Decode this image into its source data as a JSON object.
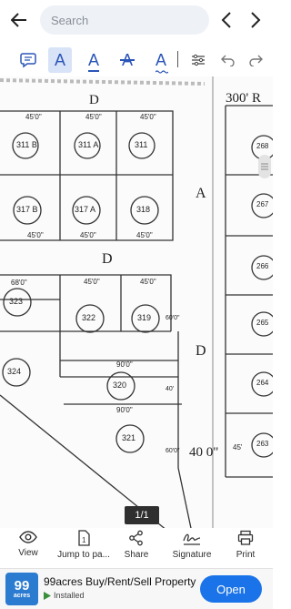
{
  "search": {
    "placeholder": "Search"
  },
  "toolbar": {
    "tools": [
      "comment-tool",
      "highlight-tool",
      "underline-tool",
      "strikethrough-tool",
      "squiggly-tool"
    ]
  },
  "document": {
    "top_dims": {
      "road_d": "D",
      "right_road": "300' R"
    },
    "plots_top": [
      {
        "label": "311 B",
        "dim": "45'0\""
      },
      {
        "label": "311 A",
        "dim": "45'0\""
      },
      {
        "label": "311",
        "dim": "45'0\""
      }
    ],
    "plots_mid": [
      {
        "label": "317 B",
        "dim": "45'0\""
      },
      {
        "label": "317 A",
        "dim": "45'0\""
      },
      {
        "label": "318",
        "dim": "45'0\""
      }
    ],
    "plots_lower": [
      "323",
      "322",
      "319",
      "324",
      "320",
      "321"
    ],
    "plots_right": [
      "268",
      "267",
      "266",
      "265",
      "264",
      "263"
    ],
    "road_labels": {
      "a": "A",
      "d_mid": "D",
      "d_right": "D"
    },
    "dims": {
      "d68": "68'0\"",
      "d45a": "45'0\"",
      "d45b": "45'0\"",
      "d60a": "60'0\"",
      "d90a": "90'0\"",
      "d40a": "40'",
      "d90b": "90'0\"",
      "d60b": "60'0\"",
      "d400": "40 0\"",
      "d45r": "45'"
    }
  },
  "page_indicator": "1/1",
  "bottom_bar": {
    "view": "View",
    "jump": "Jump to pa...",
    "share": "Share",
    "signature": "Signature",
    "print": "Print"
  },
  "ad": {
    "logo_number": "99",
    "logo_text": "acres",
    "title": "99acres Buy/Rent/Sell Property",
    "status": "Installed",
    "cta": "Open"
  },
  "colors": {
    "accent": "#1a73e8",
    "tool": "#2a55b8",
    "ad_logo": "#2b7bd1"
  }
}
